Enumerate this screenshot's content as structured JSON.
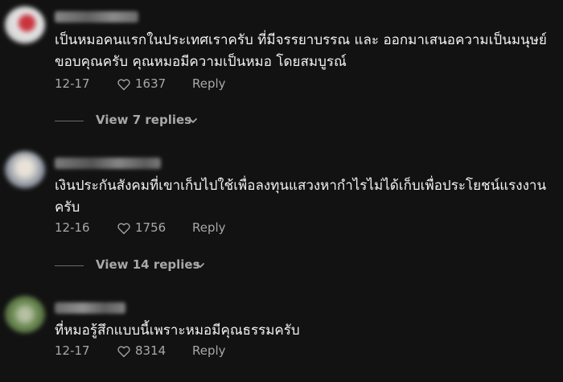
{
  "comments": [
    {
      "text": "เป็นหมอคนแรกในประเทศเราครับ  ที่มีจรรยาบรรณ และ ออกมาเสนอความเป็นมนุษย์ ขอบคุณครับ คุณหมอมีความเป็นหมอ โดยสมบูรณ์",
      "date": "12-17",
      "likes": "1637",
      "reply_label": "Reply",
      "view_replies": "View 7 replies",
      "avatar_colors": [
        "#d9d9d9",
        "#c8343c"
      ],
      "username_color": "#8a8a8a"
    },
    {
      "text": "เงินประกันสังคมที่เขาเก็บไปใช้เพื่อลงทุนแสวงหากำไรไม่ได้เก็บเพื่อประโยชน์แรงงานครับ",
      "date": "12-16",
      "likes": "1756",
      "reply_label": "Reply",
      "view_replies": "View 14 replies",
      "avatar_colors": [
        "#cfc9c0",
        "#8a8f99"
      ],
      "username_color": "#7d7d7d"
    },
    {
      "text": "ที่หมอรู้สึกแบบนี้เพราะหมอมีคุณธรรมครับ",
      "date": "12-17",
      "likes": "8314",
      "reply_label": "Reply",
      "avatar_colors": [
        "#4d6b3a",
        "#b6c0a4"
      ],
      "username_color": "#8a8a8a"
    }
  ],
  "icons": {
    "heart": "heart-outline-icon",
    "chevron": "chevron-down-icon"
  }
}
